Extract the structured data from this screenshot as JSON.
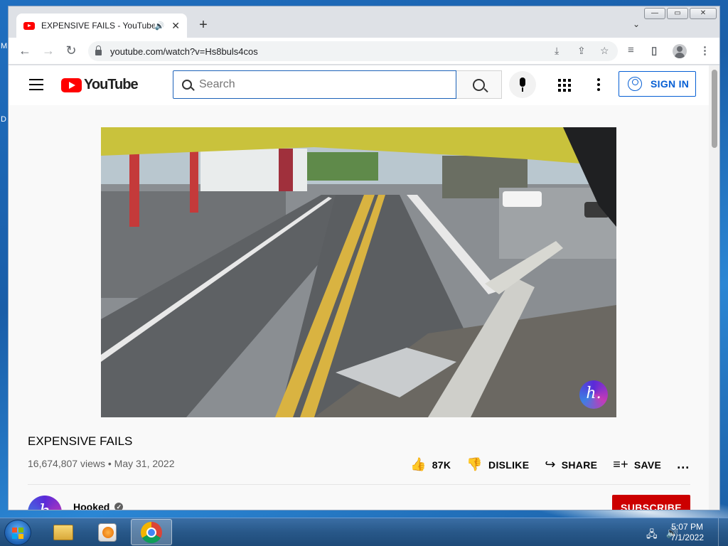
{
  "desktop": {
    "labels": [
      "M",
      "D"
    ]
  },
  "window": {
    "minimize": "—",
    "maximize": "▭",
    "close": "✕"
  },
  "tab": {
    "title": "EXPENSIVE FAILS - YouTube",
    "audio_icon": "speaker-icon",
    "close_icon": "close-icon"
  },
  "browser": {
    "new_tab": "+",
    "tab_search": "⌄",
    "back": "←",
    "forward": "→",
    "reload": "↻",
    "url": "youtube.com/watch?v=Hs8buls4cos",
    "install_icon": "⤓",
    "share_icon": "⇪",
    "star_icon": "☆",
    "media_icon": "≡",
    "sidepanel_icon": "▯",
    "menu_icon": "⋮"
  },
  "youtube": {
    "logo_text": "YouTube",
    "search_placeholder": "Search",
    "sign_in": "SIGN IN"
  },
  "video": {
    "title": "EXPENSIVE FAILS",
    "views": "16,674,807 views",
    "separator": "•",
    "date": "May 31, 2022",
    "watermark": "h."
  },
  "actions": {
    "like_icon": "👍",
    "like_count": "87K",
    "dislike_icon": "👎",
    "dislike": "DISLIKE",
    "share_icon": "↪",
    "share": "SHARE",
    "save_icon": "≡+",
    "save": "SAVE",
    "more": "..."
  },
  "channel": {
    "avatar_letter": "h",
    "name": "Hooked",
    "verified": "✓",
    "subscribe": "SUBSCRIBE"
  },
  "taskbar": {
    "tray_network": "🖧",
    "tray_volume": "🔊",
    "time": "5:07 PM",
    "date": "7/1/2022"
  },
  "colors": {
    "youtube_red": "#ff0000",
    "link_blue": "#065fd4",
    "subscribe_red": "#cc0000"
  }
}
